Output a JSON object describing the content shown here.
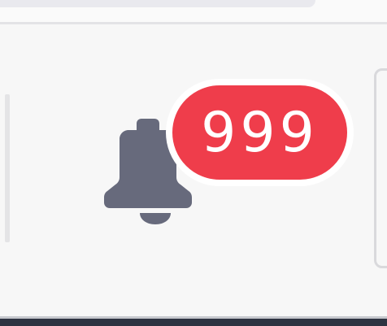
{
  "notifications": {
    "count": "999",
    "badge_color": "#ef3d4b",
    "badge_border_color": "#ffffff",
    "icon": "bell-icon",
    "icon_color": "#676a7c"
  },
  "theme": {
    "background": "#f7f7f7",
    "bottom_bar": "#2d3341"
  }
}
